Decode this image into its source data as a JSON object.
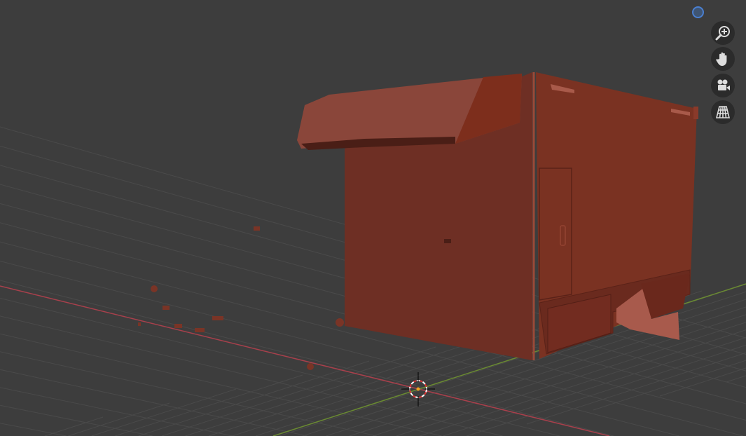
{
  "viewport": {
    "background": "#3d3d3d",
    "grid_color": "#4a4a4a",
    "x_axis_color": "#a8404c",
    "y_axis_color": "#6a8a32",
    "object_color": "#7a3426"
  },
  "navigation": {
    "gizmo_icon": "view-orientation-gizmo",
    "buttons": [
      {
        "icon": "zoom-icon",
        "tooltip": ""
      },
      {
        "icon": "pan-hand-icon"
      },
      {
        "icon": "camera-view-icon"
      },
      {
        "icon": "perspective-grid-icon"
      }
    ]
  },
  "cursor": {
    "icon": "3d-cursor-icon"
  }
}
